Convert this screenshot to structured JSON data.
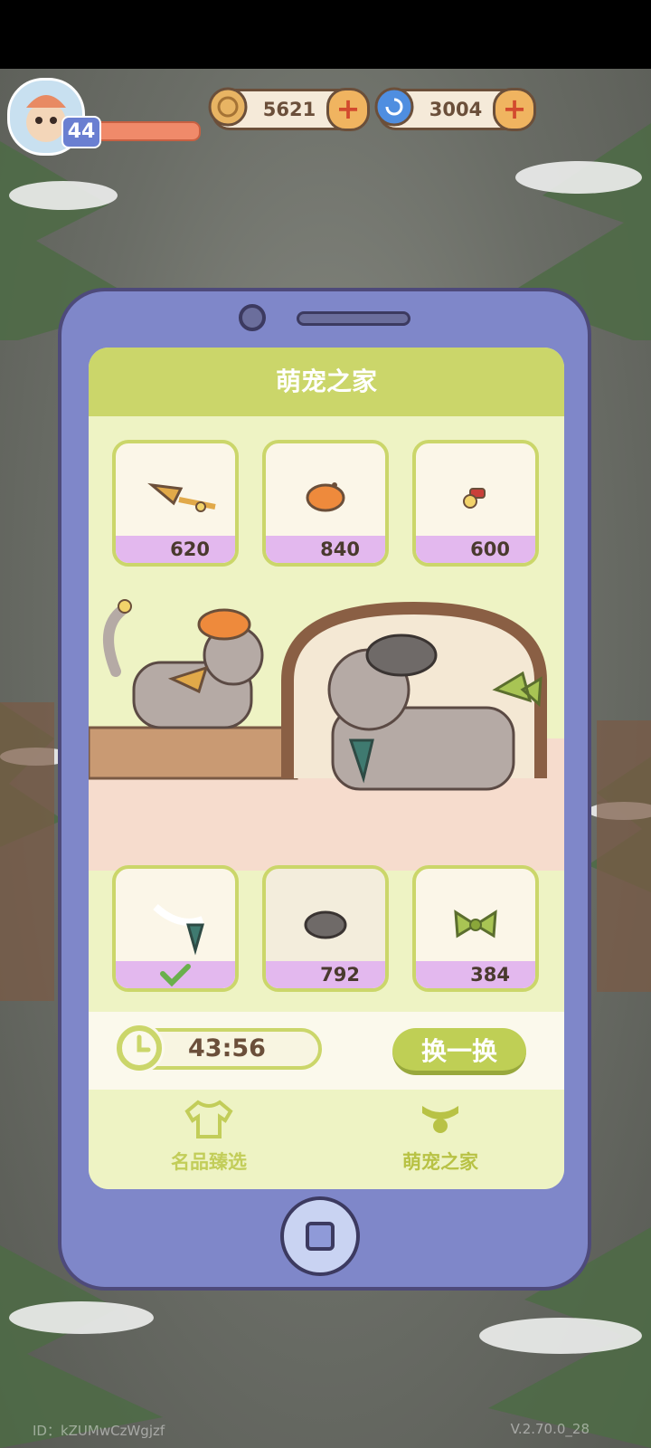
{
  "player": {
    "level": "44",
    "avatar_icon": "player-avatar-icon"
  },
  "currencies": {
    "coins": {
      "value": "5621",
      "icon": "coin-icon"
    },
    "gems": {
      "value": "3004",
      "icon": "spiral-gem-icon"
    }
  },
  "shop": {
    "title": "萌宠之家",
    "top_items": [
      {
        "name": "bell-collar-item",
        "price": "620"
      },
      {
        "name": "orange-beret-item",
        "price": "840"
      },
      {
        "name": "red-bell-item",
        "price": "600"
      }
    ],
    "bottom_items": [
      {
        "name": "tie-collar-item",
        "price": "",
        "owned": true
      },
      {
        "name": "plaid-beret-item",
        "price": "792"
      },
      {
        "name": "green-bow-item",
        "price": "384"
      }
    ],
    "timer": "43:56",
    "refresh_label": "换一换"
  },
  "tabs": [
    {
      "label": "名品臻选",
      "icon": "shirt-icon",
      "active": false
    },
    {
      "label": "萌宠之家",
      "icon": "pet-collar-icon",
      "active": true
    }
  ],
  "footer": {
    "id_text": "ID：kZUMwCzWgjzf",
    "version": "V.2.70.0_28"
  },
  "colors": {
    "accent": "#cbd66a",
    "price_band": "#e3b8ee",
    "phone": "#7f87c9"
  }
}
